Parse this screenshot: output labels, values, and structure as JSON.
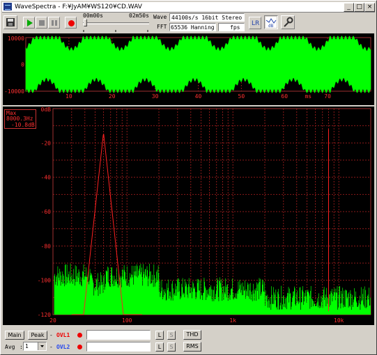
{
  "window": {
    "title": "WaveSpectra - F:¥JyAM¥WS120¥CD.WAV",
    "minimize": "_",
    "maximize": "□",
    "close": "×"
  },
  "transport": {
    "time_start": "00m00s",
    "time_end": "02m50s"
  },
  "info": {
    "wave_label": "Wave",
    "wave_value": "44100s/s 16bit Stereo",
    "fft_label": "FFT",
    "fft_value": "65536 Hanning",
    "fps_label": "fps"
  },
  "waveform": {
    "y_labels": [
      "10000",
      "0",
      "-10000"
    ],
    "x_labels": [
      "10",
      "20",
      "30",
      "40",
      "50",
      "60",
      "70"
    ],
    "x_unit": "ms"
  },
  "spectrum": {
    "max_label": "Max",
    "max_freq": "8000.3Hz",
    "max_level": "-10.8dB",
    "y_labels": [
      "0dB",
      "-20",
      "-40",
      "-60",
      "-80",
      "-100",
      "-120"
    ],
    "x_labels": [
      "20",
      "100",
      "1k",
      "10k"
    ]
  },
  "bottom": {
    "main_label": "Main",
    "peak_label": "Peak",
    "dash1": "-",
    "ovl1": "OVL1",
    "ovl2": "OVL2",
    "l_label": "L",
    "s_label": "S",
    "thd": "THD",
    "rms": "RMS",
    "avg_label": "Avg",
    "avg_value": "1",
    "dash2": "-"
  },
  "colors": {
    "wave": "#00ff00",
    "grid": "#8b1a1a",
    "spectrum_main": "#00ff00",
    "spectrum_peak": "#ff2020",
    "label": "#ff3030"
  }
}
